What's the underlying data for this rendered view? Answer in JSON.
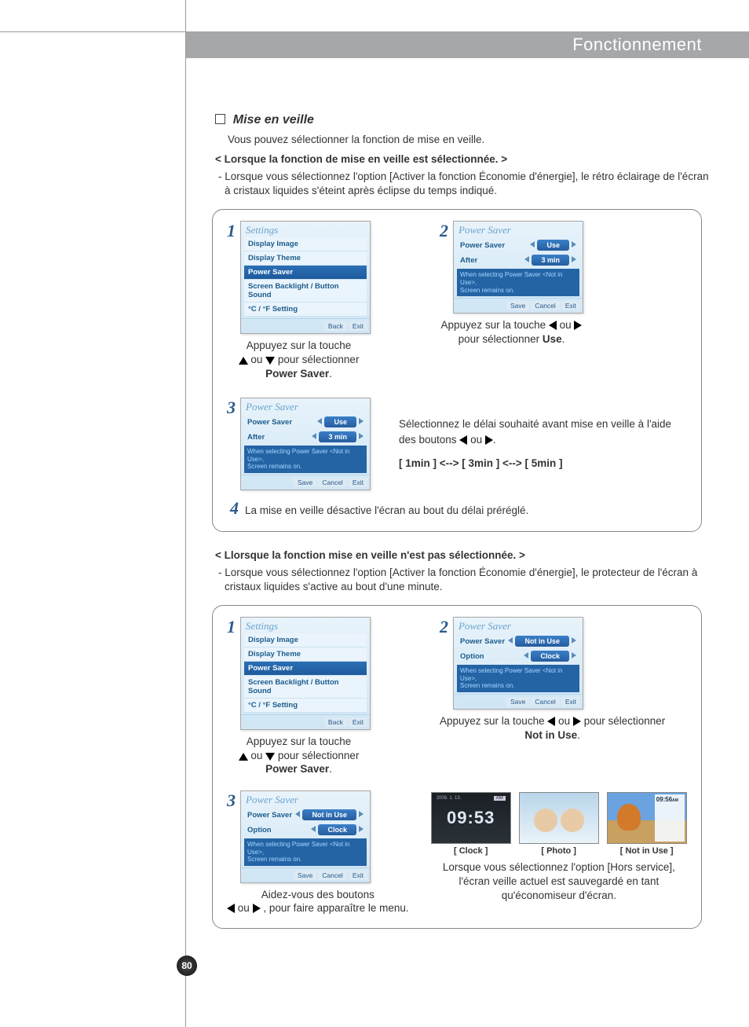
{
  "header": {
    "title": "Fonctionnement"
  },
  "section": {
    "title": "Mise en veille",
    "intro": "Vous pouvez sélectionner la fonction de mise en veille.",
    "sub1": "< Lorsque la fonction de mise en veille est sélectionnée. >",
    "note1": "- Lorsque vous sélectionnez l'option [Activer la fonction Économie d'énergie], le rétro éclairage de l'écran à cristaux liquides s'éteint après éclipse du temps indiqué.",
    "sub2": "< Llorsque la fonction mise en veille n'est pas sélectionnée. >",
    "note2": "- Lorsque vous sélectionnez l'option [Activer la fonction Économie d'énergie], le protecteur de l'écran à cristaux liquides s'active au bout d'une minute."
  },
  "screens": {
    "settings_title": "Settings",
    "menu": [
      "Display Image",
      "Display Theme",
      "Power Saver",
      "Screen Backlight / Button Sound",
      "°C / °F Setting"
    ],
    "back": "Back",
    "exit": "Exit",
    "ps_title": "Power Saver",
    "ps_label": "Power Saver",
    "after_label": "After",
    "option_label": "Option",
    "use": "Use",
    "three_min": "3 min",
    "not_in_use": "Not in Use",
    "clock_opt": "Clock",
    "hint1": "When selecting Power Saver <Not in Use>,",
    "hint2": "Screen remains on.",
    "save": "Save",
    "cancel": "Cancel"
  },
  "p1": {
    "s1_a": "Appuyez sur la touche",
    "s1_b": "ou",
    "s1_c": "pour sélectionner",
    "s1_bold": "Power Saver",
    "s1_dot": ".",
    "s2_a": "Appuyez sur la touche",
    "s2_b": "ou",
    "s2_c": "pour sélectionner ",
    "s2_bold": "Use",
    "s2_dot": ".",
    "s3_a": "Sélectionnez le délai souhaité avant mise en veille à l'aide des boutons ",
    "s3_b": " ou ",
    "s3_c": ".",
    "s3_opts": "[ 1min ] <--> [ 3min ] <--> [ 5min ]",
    "s4": "La mise en veille désactive l'écran au bout du délai préréglé."
  },
  "p2": {
    "s2_a": "Appuyez sur la touche",
    "s2_b": "ou",
    "s2_c": "pour sélectionner ",
    "s2_bold": "Not in Use",
    "s2_dot": ".",
    "s3_a": "Aidez-vous des boutons",
    "s3_b": "ou",
    "s3_c": ", pour faire apparaître le menu.",
    "thumb_clock": "[ Clock ]",
    "thumb_photo": "[ Photo ]",
    "thumb_niu": "[ Not in Use ]",
    "clock_time": "09:53",
    "clock_date": "2008. 1. 13.",
    "clock_ampm": "AM",
    "niu_time": "09:56",
    "niu_ampm": "AM",
    "desc": "Lorsque vous sélectionnez l'option [Hors service], l'écran veille actuel est sauvegardé en tant qu'économiseur d'écran."
  },
  "page_number": "80"
}
